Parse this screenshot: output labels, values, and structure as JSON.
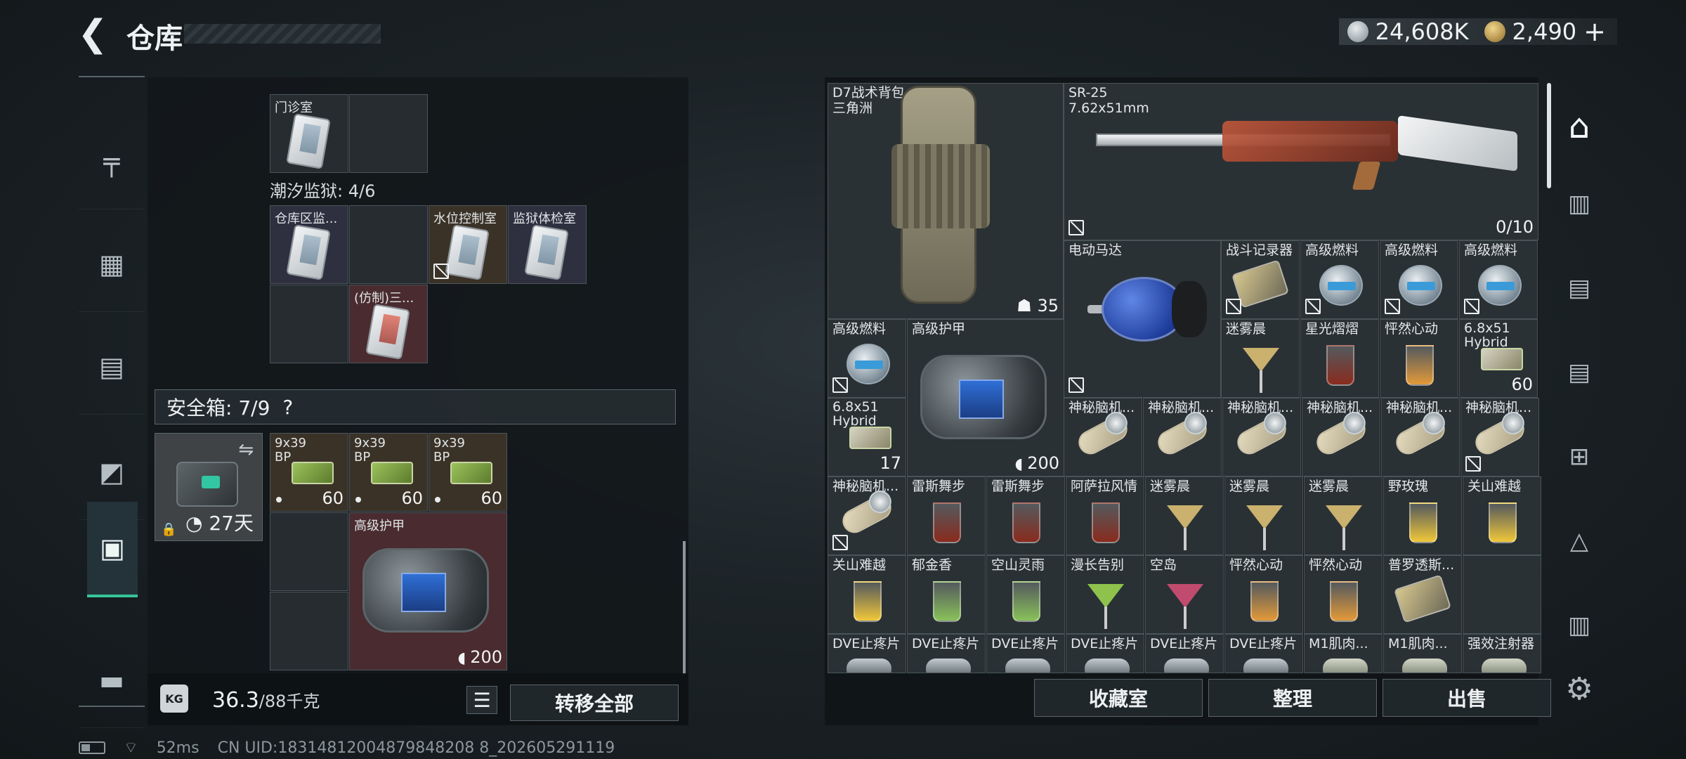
{
  "header": {
    "title": "仓库",
    "currency": [
      {
        "icon": "silver-coin-icon",
        "value": "24,608K"
      },
      {
        "icon": "gold-coin-icon",
        "value": "2,490"
      }
    ],
    "plus": "+"
  },
  "left_nav": [
    {
      "icon": "pistol-icon"
    },
    {
      "icon": "vest-icon"
    },
    {
      "icon": "backpack-icon"
    },
    {
      "icon": "rig-icon"
    },
    {
      "icon": "case-icon",
      "active": true
    },
    {
      "icon": "toolbox-icon"
    }
  ],
  "left_panel": {
    "top_card_label": "门诊室",
    "prison_title": "潮汐监狱: 4/6",
    "prison_cards": [
      "仓库区监...",
      "水位控制室",
      "监狱体检室",
      "(仿制)三..."
    ],
    "safe_box": {
      "title": "安全箱: 7/9",
      "help": "?",
      "timer": "27天"
    },
    "ammo": [
      {
        "name": "9x39\nBP",
        "count": "60"
      },
      {
        "name": "9x39\nBP",
        "count": "60"
      },
      {
        "name": "9x39\nBP",
        "count": "60"
      }
    ],
    "armor": {
      "name": "高级护甲",
      "value": "200"
    },
    "weight": {
      "current": "36.3",
      "max": "/88千克"
    },
    "kg_label": "KG",
    "transfer_all": "转移全部"
  },
  "right_panel": {
    "backpack": {
      "name": "D7战术背包",
      "sub": "三角洲",
      "count": "35"
    },
    "rifle": {
      "name": "SR-25",
      "sub": "7.62x51mm",
      "count": "0/10"
    },
    "motor": {
      "name": "电动马达"
    },
    "cells": [
      {
        "name": "战斗记录器"
      },
      {
        "name": "高级燃料"
      },
      {
        "name": "高级燃料"
      },
      {
        "name": "高级燃料"
      },
      {
        "name": "高级燃料"
      },
      {
        "name": "高级护甲",
        "value": "200"
      },
      {
        "name": "迷雾晨"
      },
      {
        "name": "星光熠熠"
      },
      {
        "name": "怦然心动"
      },
      {
        "name": "6.8x51\nHybrid",
        "count": "60"
      },
      {
        "name": "6.8x51\nHybrid",
        "count": "17"
      },
      {
        "name": "神秘脑机..."
      },
      {
        "name": "神秘脑机..."
      },
      {
        "name": "神秘脑机..."
      },
      {
        "name": "神秘脑机..."
      },
      {
        "name": "神秘脑机..."
      },
      {
        "name": "神秘脑机..."
      },
      {
        "name": "神秘脑机..."
      },
      {
        "name": "雷斯舞步"
      },
      {
        "name": "雷斯舞步"
      },
      {
        "name": "阿萨拉风情"
      },
      {
        "name": "迷雾晨"
      },
      {
        "name": "迷雾晨"
      },
      {
        "name": "迷雾晨"
      },
      {
        "name": "野玫瑰"
      },
      {
        "name": "关山难越"
      },
      {
        "name": "关山难越"
      },
      {
        "name": "郁金香"
      },
      {
        "name": "空山灵雨"
      },
      {
        "name": "漫长告别"
      },
      {
        "name": "空岛"
      },
      {
        "name": "怦然心动"
      },
      {
        "name": "怦然心动"
      },
      {
        "name": "普罗透斯..."
      },
      {
        "name": "DVE止疼片"
      },
      {
        "name": "DVE止疼片"
      },
      {
        "name": "DVE止疼片"
      },
      {
        "name": "DVE止疼片"
      },
      {
        "name": "DVE止疼片"
      },
      {
        "name": "DVE止疼片"
      },
      {
        "name": "M1肌肉..."
      },
      {
        "name": "M1肌肉..."
      },
      {
        "name": "强效注射器"
      }
    ],
    "actions": [
      "收藏室",
      "整理",
      "出售"
    ]
  },
  "right_nav": [
    {
      "icon": "home-base-icon"
    },
    {
      "icon": "storage-v-icon"
    },
    {
      "icon": "storage-iv-icon"
    },
    {
      "icon": "storage-iv-icon-2"
    },
    {
      "icon": "storage-iv-plus-icon"
    },
    {
      "icon": "storage-iv-triangle-icon"
    },
    {
      "icon": "storage-v-icon-2"
    },
    {
      "icon": "settings-gear-icon"
    }
  ],
  "status_bar": {
    "ping": "52ms",
    "uid": "CN UID:18314812004879848208 8_202605291119"
  }
}
